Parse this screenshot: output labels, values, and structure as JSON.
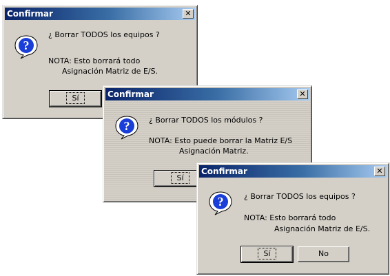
{
  "dialog1": {
    "title": "Confirmar",
    "question": "¿ Borrar TODOS los equipos ?",
    "note_line1": "NOTA: Esto borrará todo",
    "note_line2": "Asignación Matriz de E/S.",
    "yes_label": "Sí",
    "close_glyph": "✕"
  },
  "dialog2": {
    "title": "Confirmar",
    "question": "¿ Borrar TODOS los módulos ?",
    "note_line1": "NOTA: Esto puede borrar la Matriz E/S",
    "note_line2": "Asignación Matriz.",
    "yes_label": "Sí",
    "close_glyph": "✕"
  },
  "dialog3": {
    "title": "Confirmar",
    "question": "¿ Borrar TODOS los equipos ?",
    "note_line1": "NOTA: Esto borrará todo",
    "note_line2": "Asignación Matriz de E/S.",
    "yes_label": "Sí",
    "no_label": "No",
    "close_glyph": "✕"
  },
  "icons": {
    "question": "question-bubble-icon",
    "close": "close-icon"
  },
  "colors": {
    "titlebar_start": "#0a246a",
    "titlebar_end": "#a6caf0",
    "dialog_face": "#d4d0c8"
  }
}
